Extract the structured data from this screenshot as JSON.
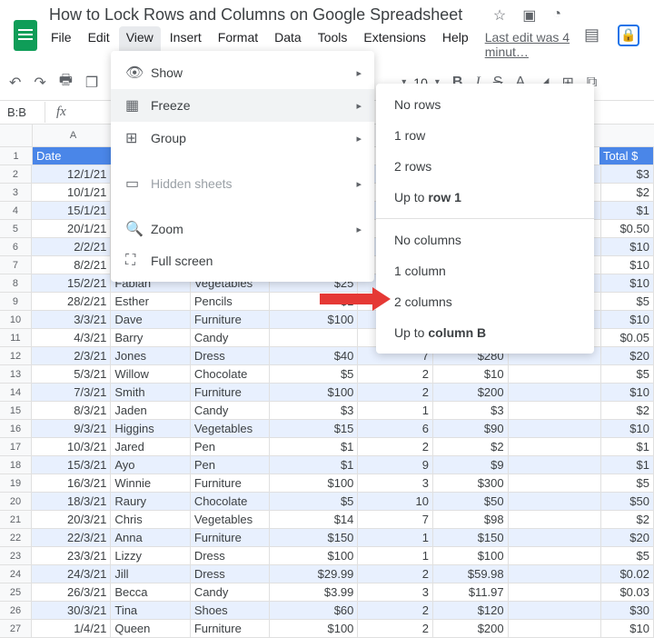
{
  "doc": {
    "title": "How to Lock Rows and Columns on Google Spreadsheet",
    "last_edit": "Last edit was 4 minut…"
  },
  "menubar": [
    "File",
    "Edit",
    "View",
    "Insert",
    "Format",
    "Data",
    "Tools",
    "Extensions",
    "Help"
  ],
  "toolbar": {
    "font_size": "10"
  },
  "formula": {
    "cell_ref": "B:B"
  },
  "view_menu": {
    "show": "Show",
    "freeze": "Freeze",
    "group": "Group",
    "hidden": "Hidden sheets",
    "zoom": "Zoom",
    "fullscreen": "Full screen"
  },
  "freeze_menu": {
    "no_rows": "No rows",
    "one_row": "1 row",
    "two_rows": "2 rows",
    "up_to_row_prefix": "Up to ",
    "up_to_row_bold": "row 1",
    "no_cols": "No columns",
    "one_col": "1 column",
    "two_cols": "2 columns",
    "up_to_col_prefix": "Up to ",
    "up_to_col_bold": "column B"
  },
  "columns": {
    "a_label": "A",
    "date": "Date",
    "total": "Total $"
  },
  "rows": [
    {
      "n": 1,
      "hdr": true
    },
    {
      "n": 2,
      "date": "12/1/21",
      "g": "",
      "h": "$3",
      "alt": true
    },
    {
      "n": 3,
      "date": "10/1/21",
      "g": "",
      "h": "$2"
    },
    {
      "n": 4,
      "date": "15/1/21",
      "g": "",
      "h": "$1",
      "alt": true
    },
    {
      "n": 5,
      "date": "20/1/21",
      "g": "",
      "h": "$0.50"
    },
    {
      "n": 6,
      "date": "2/2/21",
      "g": "",
      "h": "$10",
      "alt": true
    },
    {
      "n": 7,
      "date": "8/2/21",
      "g": "",
      "h": "$10"
    },
    {
      "n": 8,
      "date": "15/2/21",
      "b": "Fabian",
      "c": "Vegetables",
      "d": "$25",
      "g": "",
      "h": "$10",
      "alt": true
    },
    {
      "n": 9,
      "date": "28/2/21",
      "b": "Esther",
      "c": "Pencils",
      "d": "$1",
      "g": "",
      "h": "$5"
    },
    {
      "n": 10,
      "date": "3/3/21",
      "b": "Dave",
      "c": "Furniture",
      "d": "$100",
      "g": "",
      "h": "$10",
      "alt": true
    },
    {
      "n": 11,
      "date": "4/3/21",
      "b": "Barry",
      "c": "Candy",
      "d": "",
      "g": "",
      "h": "$0.05"
    },
    {
      "n": 12,
      "date": "2/3/21",
      "b": "Jones",
      "c": "Dress",
      "d": "$40",
      "e": "7",
      "f": "$280",
      "g": "",
      "h": "$20",
      "alt": true
    },
    {
      "n": 13,
      "date": "5/3/21",
      "b": "Willow",
      "c": "Chocolate",
      "d": "$5",
      "e": "2",
      "f": "$10",
      "g": "",
      "h": "$5"
    },
    {
      "n": 14,
      "date": "7/3/21",
      "b": "Smith",
      "c": "Furniture",
      "d": "$100",
      "e": "2",
      "f": "$200",
      "g": "",
      "h": "$10",
      "alt": true
    },
    {
      "n": 15,
      "date": "8/3/21",
      "b": "Jaden",
      "c": "Candy",
      "d": "$3",
      "e": "1",
      "f": "$3",
      "g": "",
      "h": "$2"
    },
    {
      "n": 16,
      "date": "9/3/21",
      "b": "Higgins",
      "c": "Vegetables",
      "d": "$15",
      "e": "6",
      "f": "$90",
      "g": "",
      "h": "$10",
      "alt": true
    },
    {
      "n": 17,
      "date": "10/3/21",
      "b": "Jared",
      "c": "Pen",
      "d": "$1",
      "e": "2",
      "f": "$2",
      "g": "",
      "h": "$1"
    },
    {
      "n": 18,
      "date": "15/3/21",
      "b": "Ayo",
      "c": "Pen",
      "d": "$1",
      "e": "9",
      "f": "$9",
      "g": "",
      "h": "$1",
      "alt": true
    },
    {
      "n": 19,
      "date": "16/3/21",
      "b": "Winnie",
      "c": "Furniture",
      "d": "$100",
      "e": "3",
      "f": "$300",
      "g": "",
      "h": "$5"
    },
    {
      "n": 20,
      "date": "18/3/21",
      "b": "Raury",
      "c": "Chocolate",
      "d": "$5",
      "e": "10",
      "f": "$50",
      "g": "",
      "h": "$50",
      "alt": true
    },
    {
      "n": 21,
      "date": "20/3/21",
      "b": "Chris",
      "c": "Vegetables",
      "d": "$14",
      "e": "7",
      "f": "$98",
      "g": "",
      "h": "$2"
    },
    {
      "n": 22,
      "date": "22/3/21",
      "b": "Anna",
      "c": "Furniture",
      "d": "$150",
      "e": "1",
      "f": "$150",
      "g": "",
      "h": "$20",
      "alt": true
    },
    {
      "n": 23,
      "date": "23/3/21",
      "b": "Lizzy",
      "c": "Dress",
      "d": "$100",
      "e": "1",
      "f": "$100",
      "g": "",
      "h": "$5"
    },
    {
      "n": 24,
      "date": "24/3/21",
      "b": "Jill",
      "c": "Dress",
      "d": "$29.99",
      "e": "2",
      "f": "$59.98",
      "g": "",
      "h": "$0.02",
      "alt": true
    },
    {
      "n": 25,
      "date": "26/3/21",
      "b": "Becca",
      "c": "Candy",
      "d": "$3.99",
      "e": "3",
      "f": "$11.97",
      "g": "",
      "h": "$0.03"
    },
    {
      "n": 26,
      "date": "30/3/21",
      "b": "Tina",
      "c": "Shoes",
      "d": "$60",
      "e": "2",
      "f": "$120",
      "g": "",
      "h": "$30",
      "alt": true
    },
    {
      "n": 27,
      "date": "1/4/21",
      "b": "Queen",
      "c": "Furniture",
      "d": "$100",
      "e": "2",
      "f": "$200",
      "g": "",
      "h": "$10"
    }
  ]
}
